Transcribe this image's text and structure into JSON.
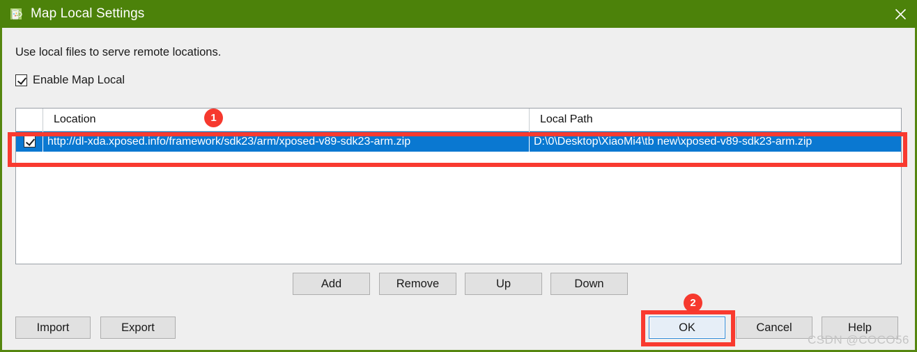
{
  "window": {
    "title": "Map Local Settings",
    "icon": "burp-jug-icon",
    "close_icon": "close-icon",
    "titlebar_color": "#4c820a",
    "border_color": "#55860f"
  },
  "content": {
    "description": "Use local files to serve remote locations.",
    "enable_checkbox": {
      "label": "Enable Map Local",
      "checked": true
    }
  },
  "table": {
    "columns": [
      "",
      "Location",
      "Local Path"
    ],
    "rows": [
      {
        "enabled": true,
        "location": "http://dl-xda.xposed.info/framework/sdk23/arm/xposed-v89-sdk23-arm.zip",
        "local_path": "D:\\0\\Desktop\\XiaoMi4\\tb  new\\xposed-v89-sdk23-arm.zip",
        "selected": true
      }
    ],
    "selection_color": "#0a78d1"
  },
  "list_buttons": {
    "add": "Add",
    "remove": "Remove",
    "up": "Up",
    "down": "Down"
  },
  "footer_buttons": {
    "import": "Import",
    "export": "Export",
    "ok": "OK",
    "cancel": "Cancel",
    "help": "Help"
  },
  "annotations": {
    "badge_1": "1",
    "badge_2": "2",
    "color": "#f93a2f"
  },
  "watermark": "CSDN @COCO56"
}
